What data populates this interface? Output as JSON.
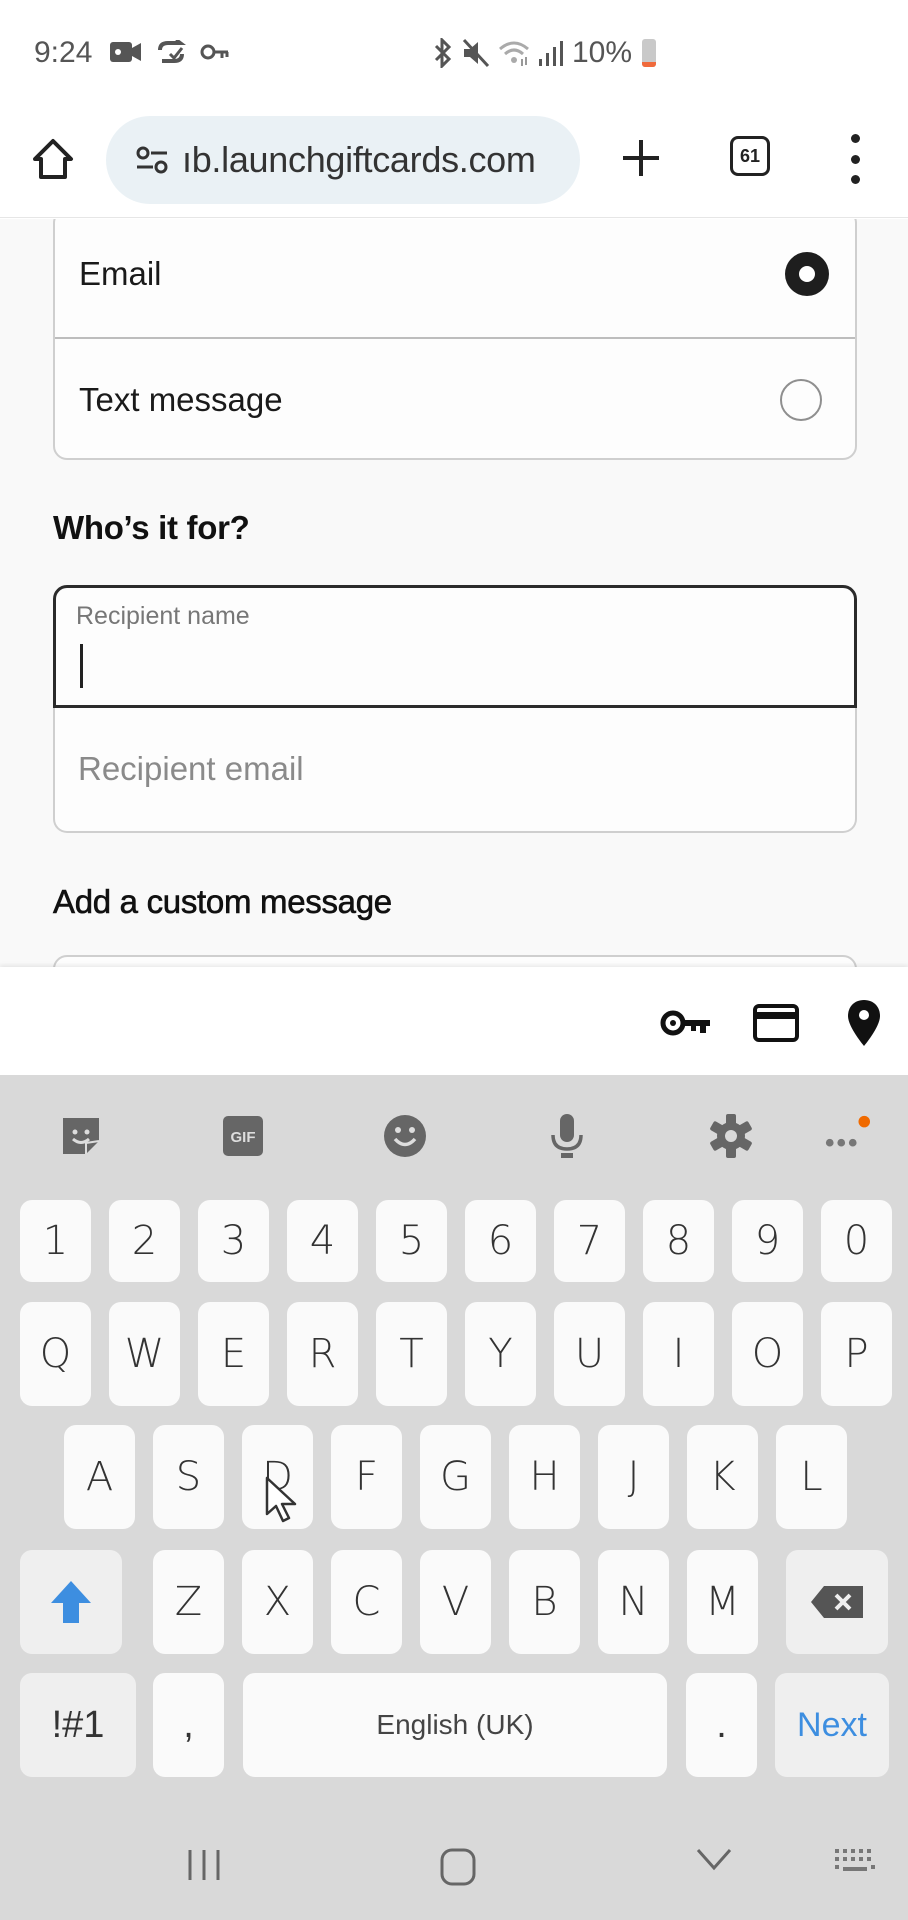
{
  "status_bar": {
    "time": "9:24",
    "left_icons": [
      "video-camera-icon",
      "sync-check-icon",
      "key-icon"
    ],
    "right_icons": [
      "bluetooth-icon",
      "mute-icon",
      "wifi-icon",
      "signal-icon"
    ],
    "battery_percent": "10%",
    "battery_color": "#f06a3c"
  },
  "browser": {
    "url": "ıb.launchgiftcards.com",
    "tab_count": "61",
    "url_bg_color": "#eaf1f5"
  },
  "delivery_options": {
    "options": [
      {
        "label": "Email",
        "selected": true
      },
      {
        "label": "Text message",
        "selected": false
      }
    ]
  },
  "recipient_section": {
    "heading": "Who’s it for?",
    "name_field": {
      "label": "Recipient name",
      "value": ""
    },
    "email_field": {
      "placeholder": "Recipient email",
      "value": ""
    }
  },
  "custom_message_section": {
    "heading": "Add a custom message"
  },
  "autofill_bar": {
    "icons": [
      "key-icon",
      "credit-card-icon",
      "location-pin-icon"
    ]
  },
  "keyboard": {
    "toolbar": [
      "sticker-icon",
      "gif-icon",
      "emoji-icon",
      "microphone-icon",
      "settings-icon",
      "more-icon"
    ],
    "gif_label": "GIF",
    "number_row": [
      "1",
      "2",
      "3",
      "4",
      "5",
      "6",
      "7",
      "8",
      "9",
      "0"
    ],
    "row1": [
      "Q",
      "W",
      "E",
      "R",
      "T",
      "Y",
      "U",
      "I",
      "O",
      "P"
    ],
    "row2": [
      "A",
      "S",
      "D",
      "F",
      "G",
      "H",
      "J",
      "K",
      "L"
    ],
    "row3": [
      "Z",
      "X",
      "C",
      "V",
      "B",
      "N",
      "M"
    ],
    "symbols_label": "!#1",
    "comma_label": ",",
    "space_label": "English (UK)",
    "period_label": ".",
    "action_label": "Next",
    "accent_color": "#3d8ee0",
    "notification_dot_color": "#f06a00"
  },
  "nav_bar": {
    "buttons": [
      "recent-apps-icon",
      "home-icon",
      "back-chevron-icon",
      "keyboard-switch-icon"
    ]
  }
}
